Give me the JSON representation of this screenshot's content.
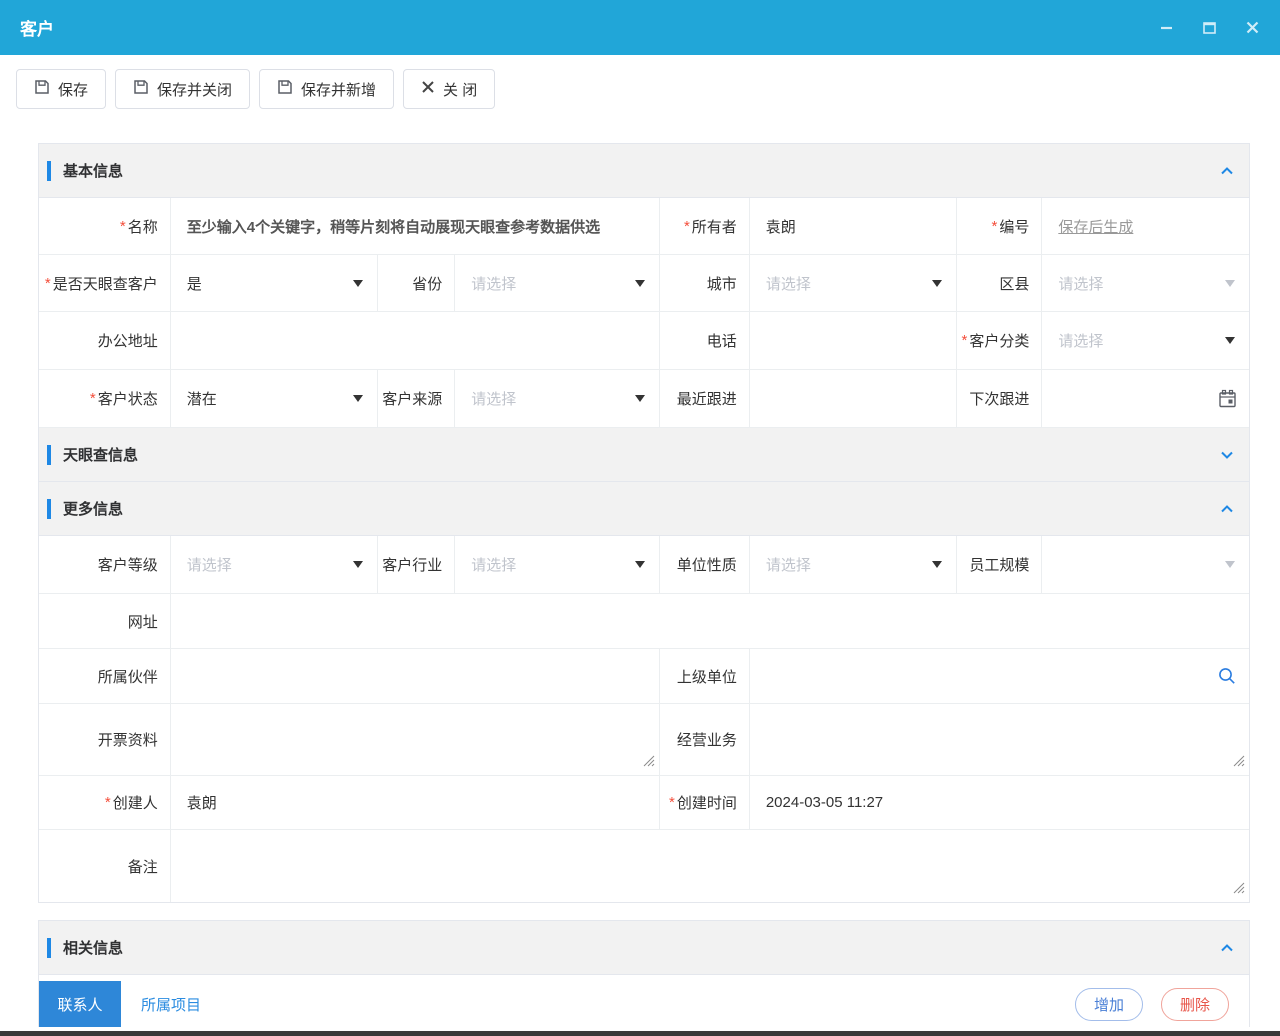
{
  "required_marker": "*",
  "window": {
    "title": "客户"
  },
  "toolbar": {
    "buttons": [
      {
        "label": "保存",
        "icon": "save-icon"
      },
      {
        "label": "保存并关闭",
        "icon": "save-icon"
      },
      {
        "label": "保存并新增",
        "icon": "save-icon"
      },
      {
        "label": "关 闭",
        "icon": "close-icon"
      }
    ]
  },
  "sections": {
    "basic": "基本信息",
    "tyc": "天眼查信息",
    "more": "更多信息",
    "related": "相关信息"
  },
  "form": {
    "name": {
      "label": "名称",
      "required": true,
      "placeholder": "至少输入4个关键字，稍等片刻将自动展现天眼查参考数据供选"
    },
    "owner": {
      "label": "所有者",
      "required": true,
      "value": "袁朗"
    },
    "code": {
      "label": "编号",
      "required": true,
      "value": "保存后生成"
    },
    "is_tyc_customer": {
      "label": "是否天眼查客户",
      "required": true,
      "value": "是"
    },
    "province": {
      "label": "省份",
      "placeholder": "请选择"
    },
    "city": {
      "label": "城市",
      "placeholder": "请选择"
    },
    "district": {
      "label": "区县",
      "placeholder": "请选择",
      "disabled": true
    },
    "office_address": {
      "label": "办公地址",
      "value": ""
    },
    "phone": {
      "label": "电话",
      "value": ""
    },
    "customer_category": {
      "label": "客户分类",
      "required": true,
      "placeholder": "请选择"
    },
    "customer_status": {
      "label": "客户状态",
      "required": true,
      "value": "潜在"
    },
    "customer_source": {
      "label": "客户来源",
      "placeholder": "请选择"
    },
    "last_followup": {
      "label": "最近跟进",
      "value": ""
    },
    "next_followup": {
      "label": "下次跟进",
      "value": ""
    },
    "customer_level": {
      "label": "客户等级",
      "placeholder": "请选择"
    },
    "customer_industry": {
      "label": "客户行业",
      "placeholder": "请选择"
    },
    "org_type": {
      "label": "单位性质",
      "placeholder": "请选择"
    },
    "staff_size": {
      "label": "员工规模",
      "value": "",
      "disabled": true
    },
    "website": {
      "label": "网址",
      "value": ""
    },
    "partner": {
      "label": "所属伙伴",
      "value": ""
    },
    "parent_org": {
      "label": "上级单位",
      "value": ""
    },
    "invoice_info": {
      "label": "开票资料",
      "value": ""
    },
    "business_scope": {
      "label": "经营业务",
      "value": ""
    },
    "creator": {
      "label": "创建人",
      "required": true,
      "value": "袁朗"
    },
    "create_time": {
      "label": "创建时间",
      "required": true,
      "value": "2024-03-05 11:27"
    },
    "remark": {
      "label": "备注",
      "value": ""
    }
  },
  "related": {
    "tabs": [
      {
        "label": "联系人",
        "active": true
      },
      {
        "label": "所属项目",
        "active": false
      }
    ],
    "add_label": "增加",
    "delete_label": "删除"
  },
  "colors": {
    "titlebar": "#21a6d8",
    "accent": "#1e88e5",
    "active_tab": "#2e87d8",
    "section_bg": "#f2f2f2",
    "required": "#f44e3b",
    "add_button": "#4a7fd6",
    "delete_button": "#e85549",
    "placeholder": "#c0c4cc",
    "link": "#999999"
  }
}
